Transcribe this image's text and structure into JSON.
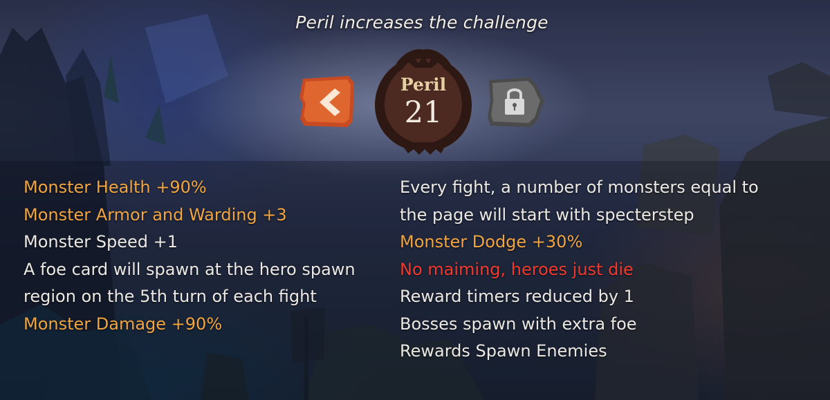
{
  "screen": {
    "title": "Peril increases the challenge"
  },
  "peril": {
    "label": "Peril",
    "value": "21"
  },
  "controls": {
    "prev_icon": "chevron-left-icon",
    "next_icon": "lock-icon",
    "next_locked": true
  },
  "colors": {
    "modifier_orange": "#f0a542",
    "modifier_white": "#ece9e4",
    "modifier_red": "#f03a2e",
    "prev_button": "#d2582c",
    "badge": "#4a2820"
  },
  "modifiers_left": [
    {
      "text": "Monster Health +90%",
      "color": "orange"
    },
    {
      "text": "Monster Armor and Warding +3",
      "color": "orange"
    },
    {
      "text": "Monster Speed +1",
      "color": "white"
    },
    {
      "text": "A foe card will spawn at the hero spawn",
      "color": "white"
    },
    {
      "text": "region on the 5th turn of each fight",
      "color": "white"
    },
    {
      "text": "Monster Damage +90%",
      "color": "orange"
    }
  ],
  "modifiers_right": [
    {
      "text": "Every fight, a number of monsters equal to",
      "color": "white"
    },
    {
      "text": "the page will start with specterstep",
      "color": "white"
    },
    {
      "text": "Monster Dodge +30%",
      "color": "orange"
    },
    {
      "text": "No maiming, heroes just die",
      "color": "red"
    },
    {
      "text": "Reward timers reduced by 1",
      "color": "white"
    },
    {
      "text": "Bosses spawn with extra foe",
      "color": "white"
    },
    {
      "text": "Rewards Spawn Enemies",
      "color": "white"
    }
  ]
}
